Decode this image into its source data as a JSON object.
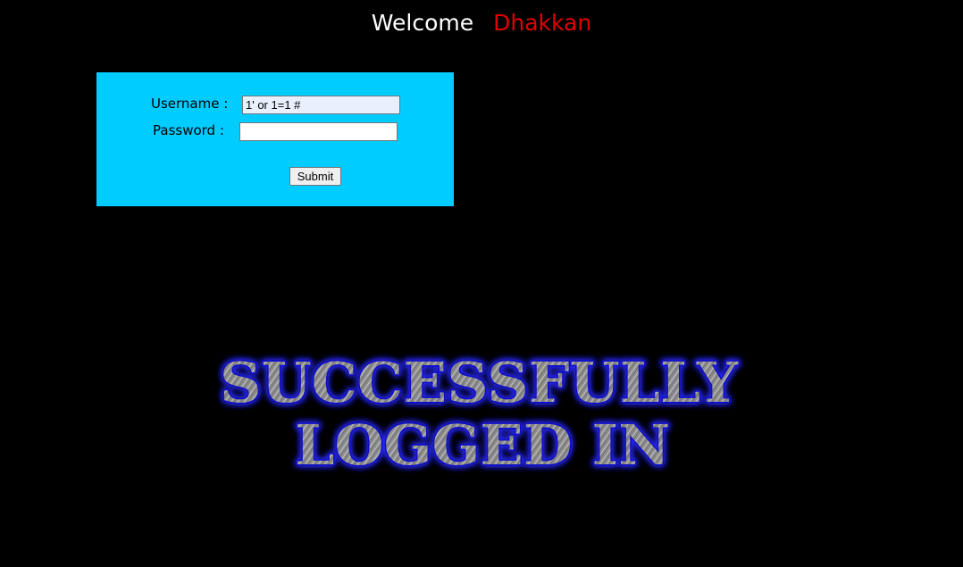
{
  "header": {
    "welcome": "Welcome",
    "name": "Dhakkan"
  },
  "form": {
    "username_label": "Username :",
    "password_label": "Password :",
    "username_value": "1' or 1=1 #",
    "password_value": "",
    "submit_label": "Submit"
  },
  "banner": {
    "line1": "SUCCESSFULLY",
    "line2": "LOGGED IN"
  },
  "colors": {
    "background": "#000000",
    "panel": "#00ccff",
    "name_accent": "#e00000",
    "banner_glow": "#1a1aff",
    "banner_fill": "#9a9a9a"
  }
}
